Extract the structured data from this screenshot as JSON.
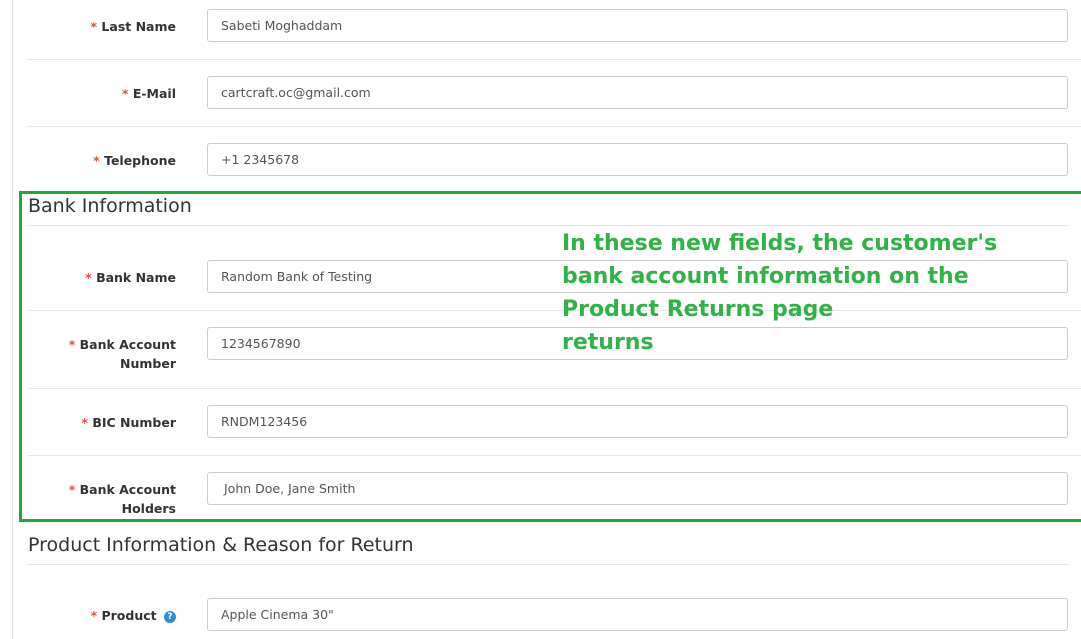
{
  "required_marker": "*",
  "customer": {
    "last_name": {
      "label": "Last Name",
      "value": "Sabeti Moghaddam"
    },
    "email": {
      "label": "E-Mail",
      "value": "cartcraft.oc@gmail.com"
    },
    "telephone": {
      "label": "Telephone",
      "value": "+1 2345678"
    }
  },
  "bank": {
    "legend": "Bank Information",
    "bank_name": {
      "label": "Bank Name",
      "value": "Random Bank of Testing"
    },
    "account_number": {
      "label_line1": "Bank Account",
      "label_line2": "Number",
      "value": "1234567890"
    },
    "bic": {
      "label": "BIC Number",
      "value": "RNDM123456"
    },
    "account_holders": {
      "label_line1": "Bank Account",
      "label_line2": "Holders",
      "value": "John Doe, Jane Smith"
    }
  },
  "annotation": {
    "text": "In these new fields, the customer's\nbank account information on the\nProduct Returns page\nreturns",
    "color": "#2fb347",
    "box_color": "#22a83a"
  },
  "product": {
    "legend": "Product Information & Reason for Return",
    "product": {
      "label": "Product",
      "value": "Apple Cinema 30\"",
      "help_icon": "question-circle-icon"
    }
  },
  "colors": {
    "required": "#e3503e",
    "help": "#2a8fd6"
  }
}
